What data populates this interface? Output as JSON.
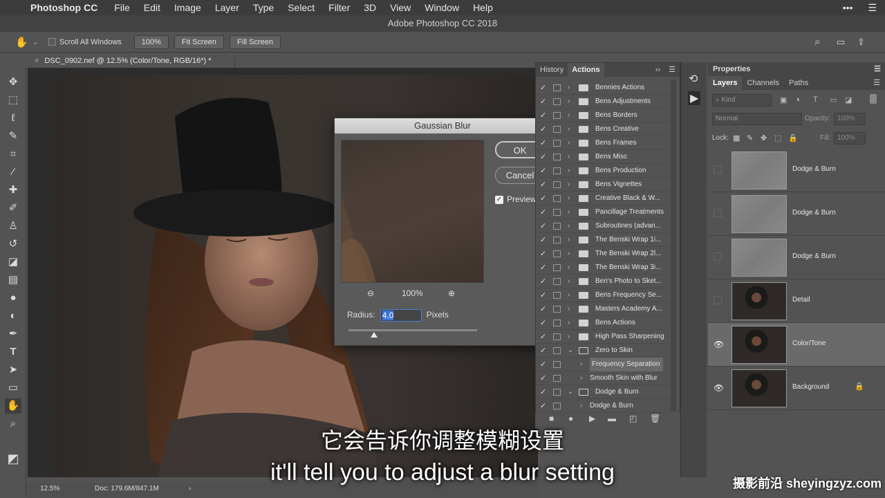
{
  "menubar": {
    "app": "Photoshop CC",
    "items": [
      "File",
      "Edit",
      "Image",
      "Layer",
      "Type",
      "Select",
      "Filter",
      "3D",
      "View",
      "Window",
      "Help"
    ],
    "right_icons": [
      "more-icon",
      "menu-list-icon"
    ]
  },
  "window_title": "Adobe Photoshop CC 2018",
  "options": {
    "scroll_all": "Scroll All Windows",
    "zoom_btn": "100%",
    "fit_screen": "Fit Screen",
    "fill_screen": "Fill Screen"
  },
  "doc_tab": "DSC_0902.nef @ 12.5% (Color/Tone, RGB/16*) *",
  "status": {
    "zoom": "12.5%",
    "doc": "Doc: 179.6M/847.1M"
  },
  "gaussian": {
    "title": "Gaussian Blur",
    "ok": "OK",
    "cancel": "Cancel",
    "preview": "Preview",
    "zoom": "100%",
    "radius_label": "Radius:",
    "radius_value": "4.0",
    "unit": "Pixels"
  },
  "history_tab": "History",
  "actions_tab": "Actions",
  "actions": [
    {
      "label": "Bennies Actions",
      "check": "✓",
      "type": "folder"
    },
    {
      "label": "Bens Adjustments",
      "check": "✓",
      "type": "folder"
    },
    {
      "label": "Bens Borders",
      "check": "✓",
      "type": "folder"
    },
    {
      "label": "Bens Creative",
      "check": "✓",
      "type": "folder"
    },
    {
      "label": "Bens Frames",
      "check": "✓",
      "type": "folder"
    },
    {
      "label": "Bens Misc",
      "check": "✓",
      "type": "folder"
    },
    {
      "label": "Bens Production",
      "check": "✓",
      "type": "folder"
    },
    {
      "label": "Bens Vignettes",
      "check": "✓",
      "type": "folder"
    },
    {
      "label": "Creative Black & W...",
      "check": "✓",
      "type": "folder"
    },
    {
      "label": "Pancillage Treatments",
      "check": "✓",
      "type": "folder"
    },
    {
      "label": "Subroutines (advan...",
      "check": "✓",
      "type": "folder"
    },
    {
      "label": "The Benski Wrap 1i...",
      "check": "✓",
      "type": "folder"
    },
    {
      "label": "The Benski Wrap 2l...",
      "check": "✓",
      "type": "folder"
    },
    {
      "label": "The Benski Wrap 3i...",
      "check": "✓",
      "type": "folder"
    },
    {
      "label": "Ben's Photo to Sket...",
      "check": "✓",
      "type": "folder"
    },
    {
      "label": "Bens Frequency Se...",
      "check": "✓",
      "type": "folder"
    },
    {
      "label": "Masters Academy A...",
      "check": "✓",
      "type": "folder"
    },
    {
      "label": "Bens Actions",
      "check": "✓",
      "type": "folder"
    },
    {
      "label": "High Pass Sharpening",
      "check": "✓",
      "type": "folder"
    },
    {
      "label": "Zero to Skin",
      "check": "✓",
      "type": "open-folder"
    },
    {
      "label": "Frequency Separation",
      "check": "✓",
      "type": "action-active"
    },
    {
      "label": "Smooth Skin with Blur",
      "check": "✓",
      "type": "action"
    },
    {
      "label": "Dodge & Burn",
      "check": "✓",
      "type": "open-folder"
    },
    {
      "label": "Dodge & Burn",
      "check": "✓",
      "type": "action"
    }
  ],
  "properties_title": "Properties",
  "layer_tabs": [
    "Layers",
    "Channels",
    "Paths"
  ],
  "layer_controls": {
    "kind": "Kind",
    "blend": "Normal",
    "opacity_label": "Opacity:",
    "opacity": "100%",
    "lock_label": "Lock:",
    "fill_label": "Fill:",
    "fill": "100%"
  },
  "layers": [
    {
      "name": "Dodge & Burn",
      "visible": false,
      "thumb": "gray",
      "selected": false
    },
    {
      "name": "Dodge & Burn",
      "visible": false,
      "thumb": "gray",
      "selected": false
    },
    {
      "name": "Dodge & Burn",
      "visible": false,
      "thumb": "gray",
      "selected": false
    },
    {
      "name": "Detail",
      "visible": false,
      "thumb": "photo",
      "selected": false
    },
    {
      "name": "Color/Tone",
      "visible": true,
      "thumb": "photo",
      "selected": true
    },
    {
      "name": "Background",
      "visible": true,
      "thumb": "photo",
      "selected": false,
      "locked": true
    }
  ],
  "subtitle_cn": "它会告诉你调整模糊设置",
  "subtitle_en": "it'll tell you to adjust a blur setting",
  "watermark": "摄影前沿 sheyingzyz.com"
}
